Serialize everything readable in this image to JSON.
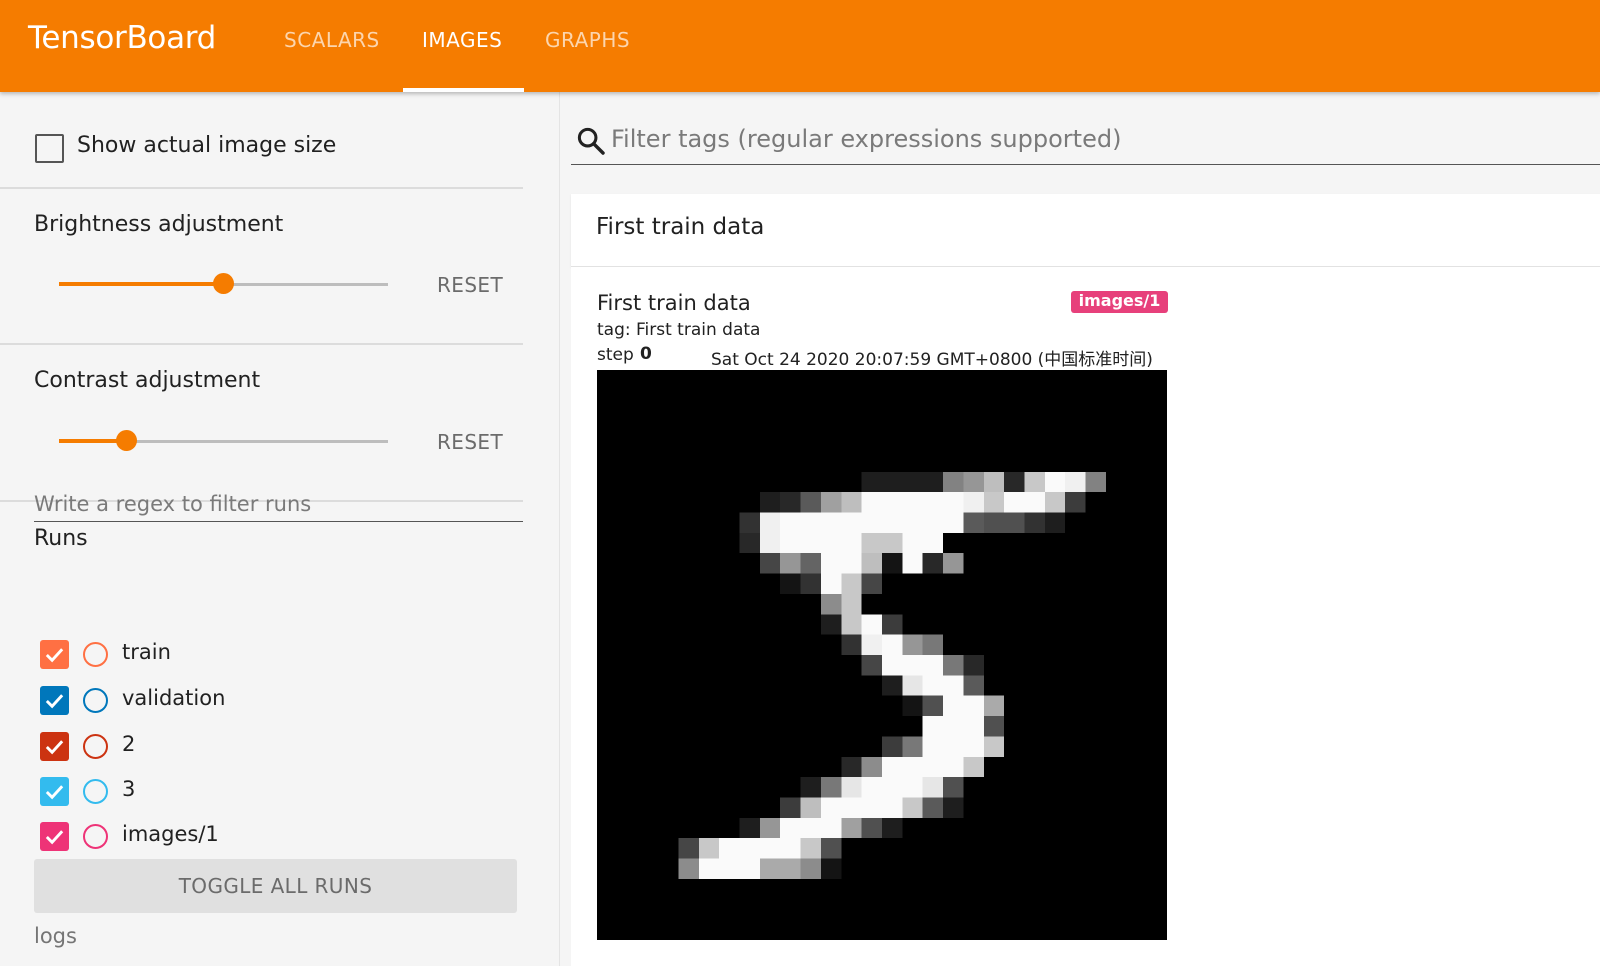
{
  "header": {
    "brand": "TensorBoard",
    "tabs": [
      {
        "label": "SCALARS",
        "active": false
      },
      {
        "label": "IMAGES",
        "active": true
      },
      {
        "label": "GRAPHS",
        "active": false
      }
    ],
    "color": "#f57c00"
  },
  "sidebar": {
    "show_actual_size_label": "Show actual image size",
    "show_actual_size_checked": false,
    "brightness": {
      "label": "Brightness adjustment",
      "value_fraction": 0.5,
      "reset_label": "RESET"
    },
    "contrast": {
      "label": "Contrast adjustment",
      "value_fraction": 0.2,
      "reset_label": "RESET"
    },
    "runs": {
      "title": "Runs",
      "filter_placeholder": "Write a regex to filter runs",
      "items": [
        {
          "label": "train",
          "checked": true,
          "color": "#ff7043"
        },
        {
          "label": "validation",
          "checked": true,
          "color": "#0077bb"
        },
        {
          "label": "2",
          "checked": true,
          "color": "#cc3311"
        },
        {
          "label": "3",
          "checked": true,
          "color": "#33bbee"
        },
        {
          "label": "images/1",
          "checked": true,
          "color": "#ee3377"
        }
      ],
      "toggle_all_label": "TOGGLE ALL RUNS",
      "logdir_label": "logs"
    }
  },
  "main": {
    "filter_placeholder": "Filter tags (regular expressions supported)",
    "search_icon": "search-icon",
    "card": {
      "title": "First train data",
      "image": {
        "title": "First train data",
        "tag": "tag: First train data",
        "step_label": "step",
        "step_value": "0",
        "wall_time": "Sat Oct 24 2020 20:07:59 GMT+0800 (中国标准时间)",
        "run_badge": "images/1",
        "run_badge_color": "#e7407b"
      }
    }
  }
}
